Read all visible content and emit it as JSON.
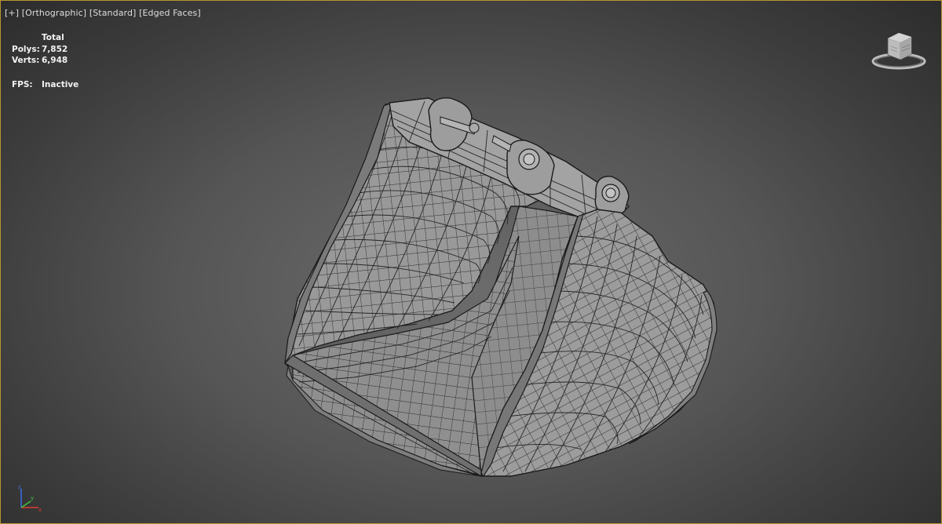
{
  "viewport": {
    "labels": {
      "plus": "[+]",
      "projection": "[Orthographic]",
      "shading": "[Standard]",
      "display": "[Edged Faces]"
    },
    "stats": {
      "header": "Total",
      "polys_label": "Polys:",
      "polys_value": "7,852",
      "verts_label": "Verts:",
      "verts_value": "6,948",
      "fps_label": "FPS:",
      "fps_value": "Inactive"
    },
    "viewcube_icon": "viewcube-icon",
    "axis_icon": "axis-tripod-icon",
    "colors": {
      "border": "#b8952f",
      "axis_x": "#e03c31",
      "axis_y": "#3cc43c",
      "axis_z": "#3c6ce0"
    }
  }
}
